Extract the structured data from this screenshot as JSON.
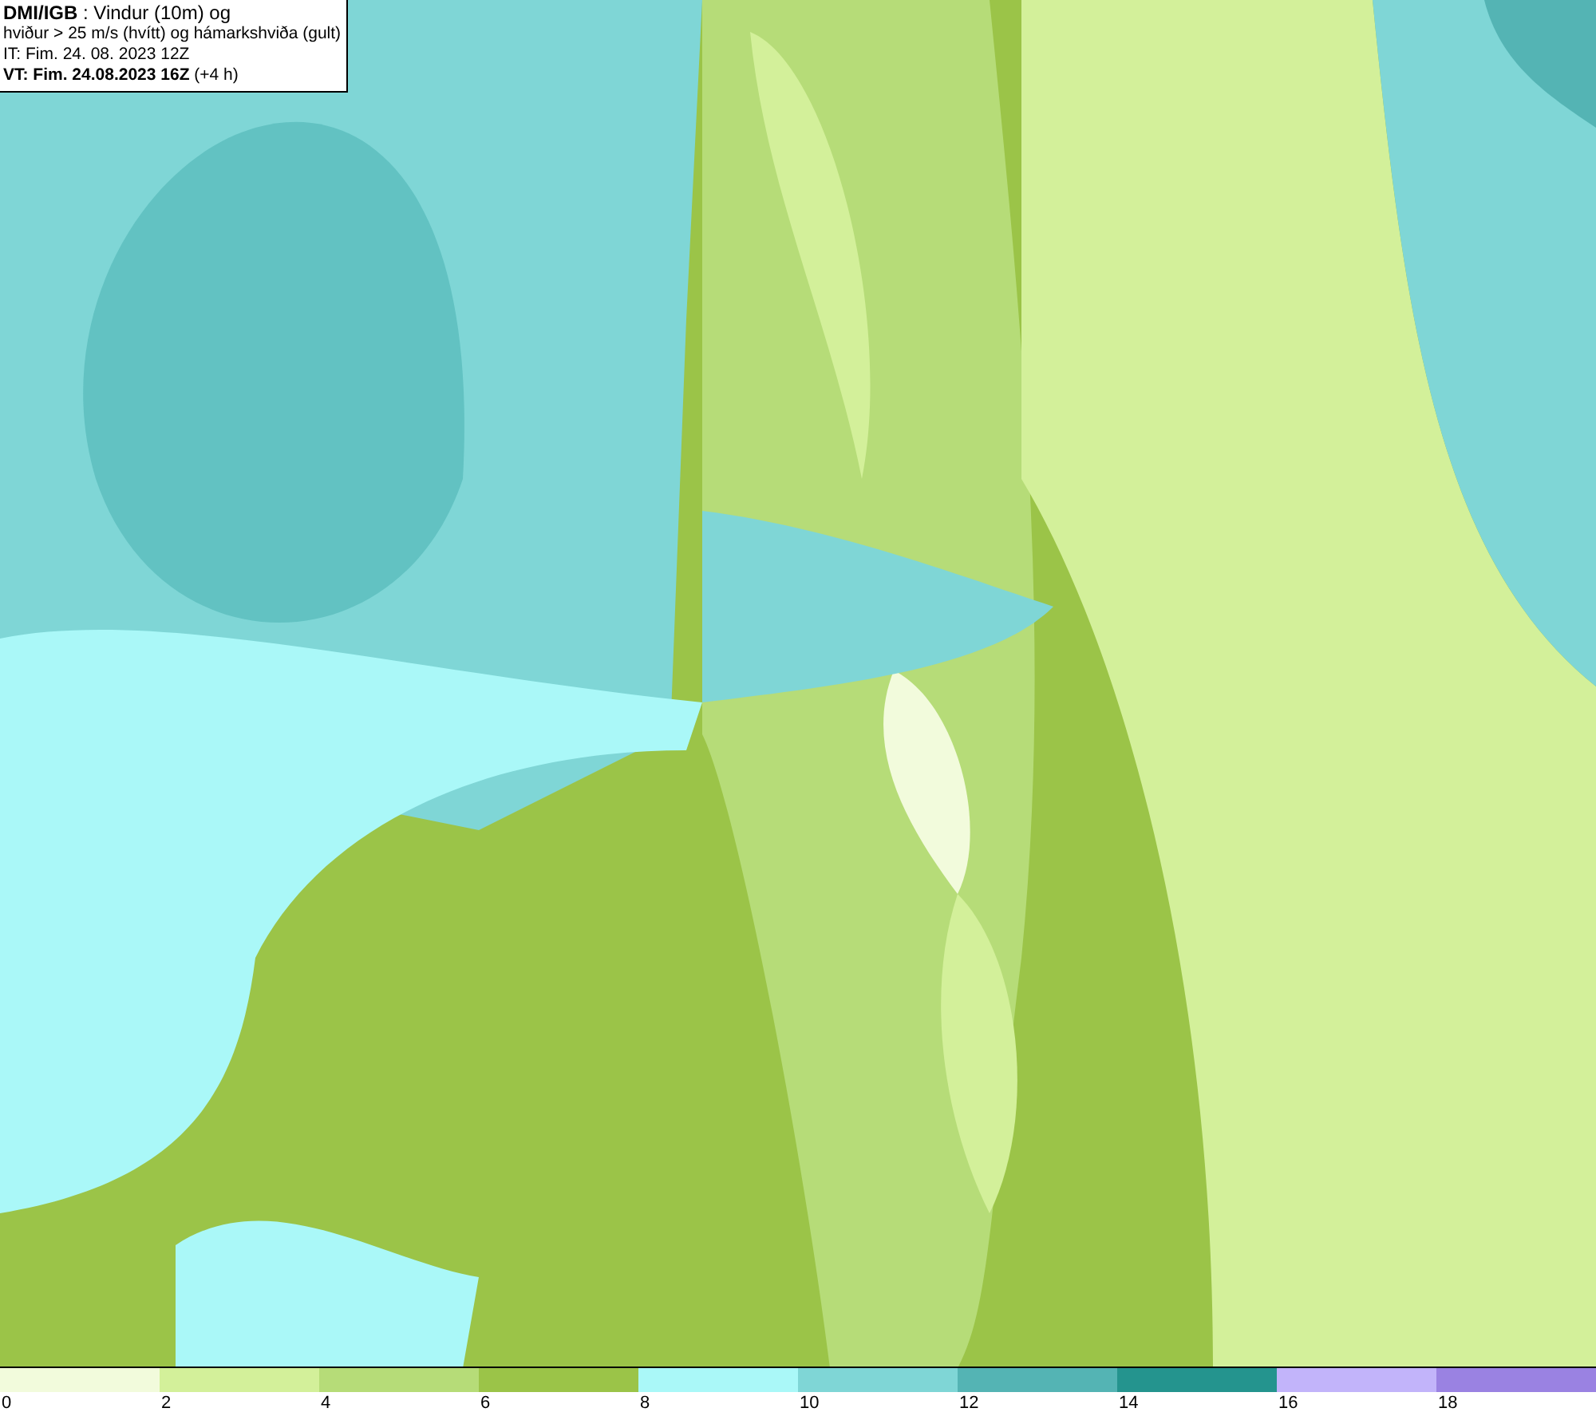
{
  "header": {
    "lines": [
      "**DMI/IGB** : Vindur (10m) og",
      "hviður > 25 m/s (hvítt) og hámarkshviða (gult)",
      "IT: Fim. 24. 08. 2023 12Z",
      "**VT: Fim. 24.08.2023 16Z** (+4 h)"
    ]
  },
  "legend": {
    "swatches": [
      {
        "color": "#f2fbdc"
      },
      {
        "color": "#d3f09a"
      },
      {
        "color": "#b6dc78"
      },
      {
        "color": "#9bc448"
      },
      {
        "color": "#aaf8f8"
      },
      {
        "color": "#7fd6d6"
      },
      {
        "color": "#54b4b4"
      },
      {
        "color": "#24948e"
      },
      {
        "color": "#c2b4fa"
      },
      {
        "color": "#9a82e2"
      }
    ],
    "labels": [
      "0",
      "2",
      "4",
      "6",
      "8",
      "10",
      "12",
      "14",
      "16",
      "18"
    ]
  }
}
